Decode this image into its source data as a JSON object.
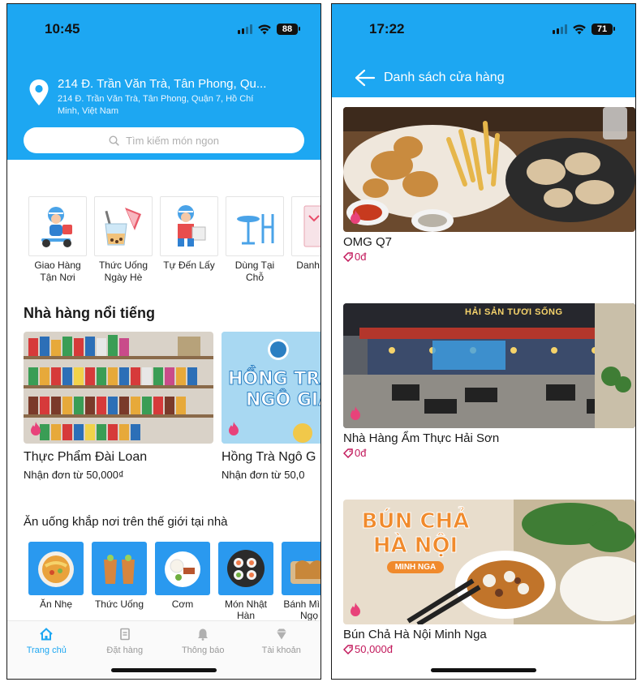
{
  "colors": {
    "brand": "#1da7f2",
    "price": "#c2185b",
    "inactive": "#9a9a9a"
  },
  "left": {
    "status": {
      "time": "10:45",
      "battery": "88"
    },
    "address": {
      "title": "214 Đ. Trần Văn Trà, Tân Phong, Qu...",
      "detail": "214 Đ. Trần Văn Trà, Tân Phong, Quận 7, Hồ Chí Minh, Việt Nam"
    },
    "search": {
      "placeholder": "Tìm kiếm món ngon"
    },
    "categories": [
      {
        "label": "Giao Hàng Tận Nơi",
        "icon": "delivery-icon"
      },
      {
        "label": "Thức Uống Ngày Hè",
        "icon": "drinks-icon"
      },
      {
        "label": "Tự Đến Lấy",
        "icon": "pickup-icon"
      },
      {
        "label": "Dùng Tại Chỗ",
        "icon": "dine-in-icon"
      },
      {
        "label": "Danh Ưa T",
        "icon": "favorite-icon"
      }
    ],
    "featured_title": "Nhà hàng nổi tiếng",
    "featured": [
      {
        "name": "Thực Phẩm Đài Loan",
        "sub": "Nhận đơn từ 50,000₫"
      },
      {
        "name": "Hồng Trà Ngô G",
        "sub": "Nhận đơn từ 50,0",
        "image_text": [
          "HỒNG TRÀ",
          "NGÔ GIA"
        ]
      }
    ],
    "world_title": "Ăn uống khắp nơi trên thế giới tại nhà",
    "world": [
      {
        "label": "Ăn Nhẹ"
      },
      {
        "label": "Thức Uống"
      },
      {
        "label": "Cơm"
      },
      {
        "label": "Món Nhật Hàn"
      },
      {
        "label": "Bánh Mì Đồ Ngọ"
      }
    ],
    "tabs": [
      {
        "label": "Trang chủ",
        "icon": "home-icon",
        "active": true
      },
      {
        "label": "Đặt hàng",
        "icon": "orders-icon",
        "active": false
      },
      {
        "label": "Thông báo",
        "icon": "bell-icon",
        "active": false
      },
      {
        "label": "Tài khoản",
        "icon": "account-icon",
        "active": false
      }
    ]
  },
  "right": {
    "status": {
      "time": "17:22",
      "battery": "71"
    },
    "title": "Danh sách cửa hàng",
    "stores": [
      {
        "name": "OMG Q7",
        "price": "0đ"
      },
      {
        "name": "Nhà Hàng Ẩm Thực Hải Sơn",
        "price": "0đ",
        "image_text": "HẢI SẢN TƯƠI SỐNG"
      },
      {
        "name": "Bún Chả Hà Nội Minh Nga",
        "price": "50,000đ",
        "image_text": [
          "BÚN CHẢ",
          "HÀ NỘI",
          "MINH NGA"
        ]
      }
    ]
  }
}
